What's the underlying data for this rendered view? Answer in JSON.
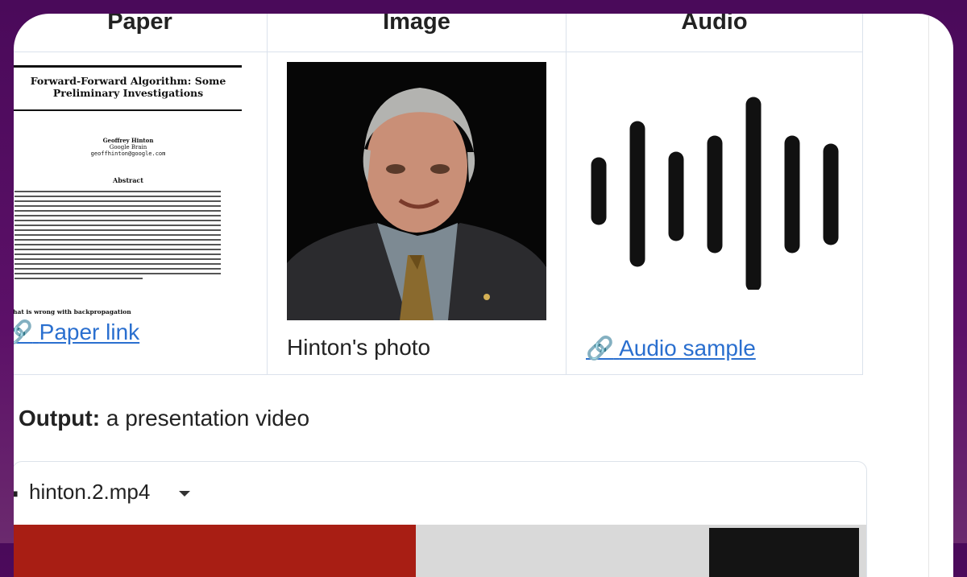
{
  "table": {
    "headers": [
      "Paper",
      "Image",
      "Audio"
    ],
    "paper": {
      "title": "Forward-Forward Algorithm: Some Preliminary Investigations",
      "author": "Geoffrey Hinton",
      "affiliation": "Google Brain",
      "email": "geoffhinton@google.com",
      "abstract_heading": "Abstract",
      "section_heading": "hat is wrong with backpropagation",
      "link_label": "Paper link"
    },
    "image": {
      "caption": "Hinton's photo"
    },
    "audio": {
      "link_label": "Audio sample"
    }
  },
  "output": {
    "label": "Output:",
    "text": "a presentation video"
  },
  "video": {
    "filename": "hinton.2.mp4"
  },
  "colors": {
    "link": "#2a6fcf",
    "background": "#4a0a5a",
    "video_red": "#a81e14"
  }
}
